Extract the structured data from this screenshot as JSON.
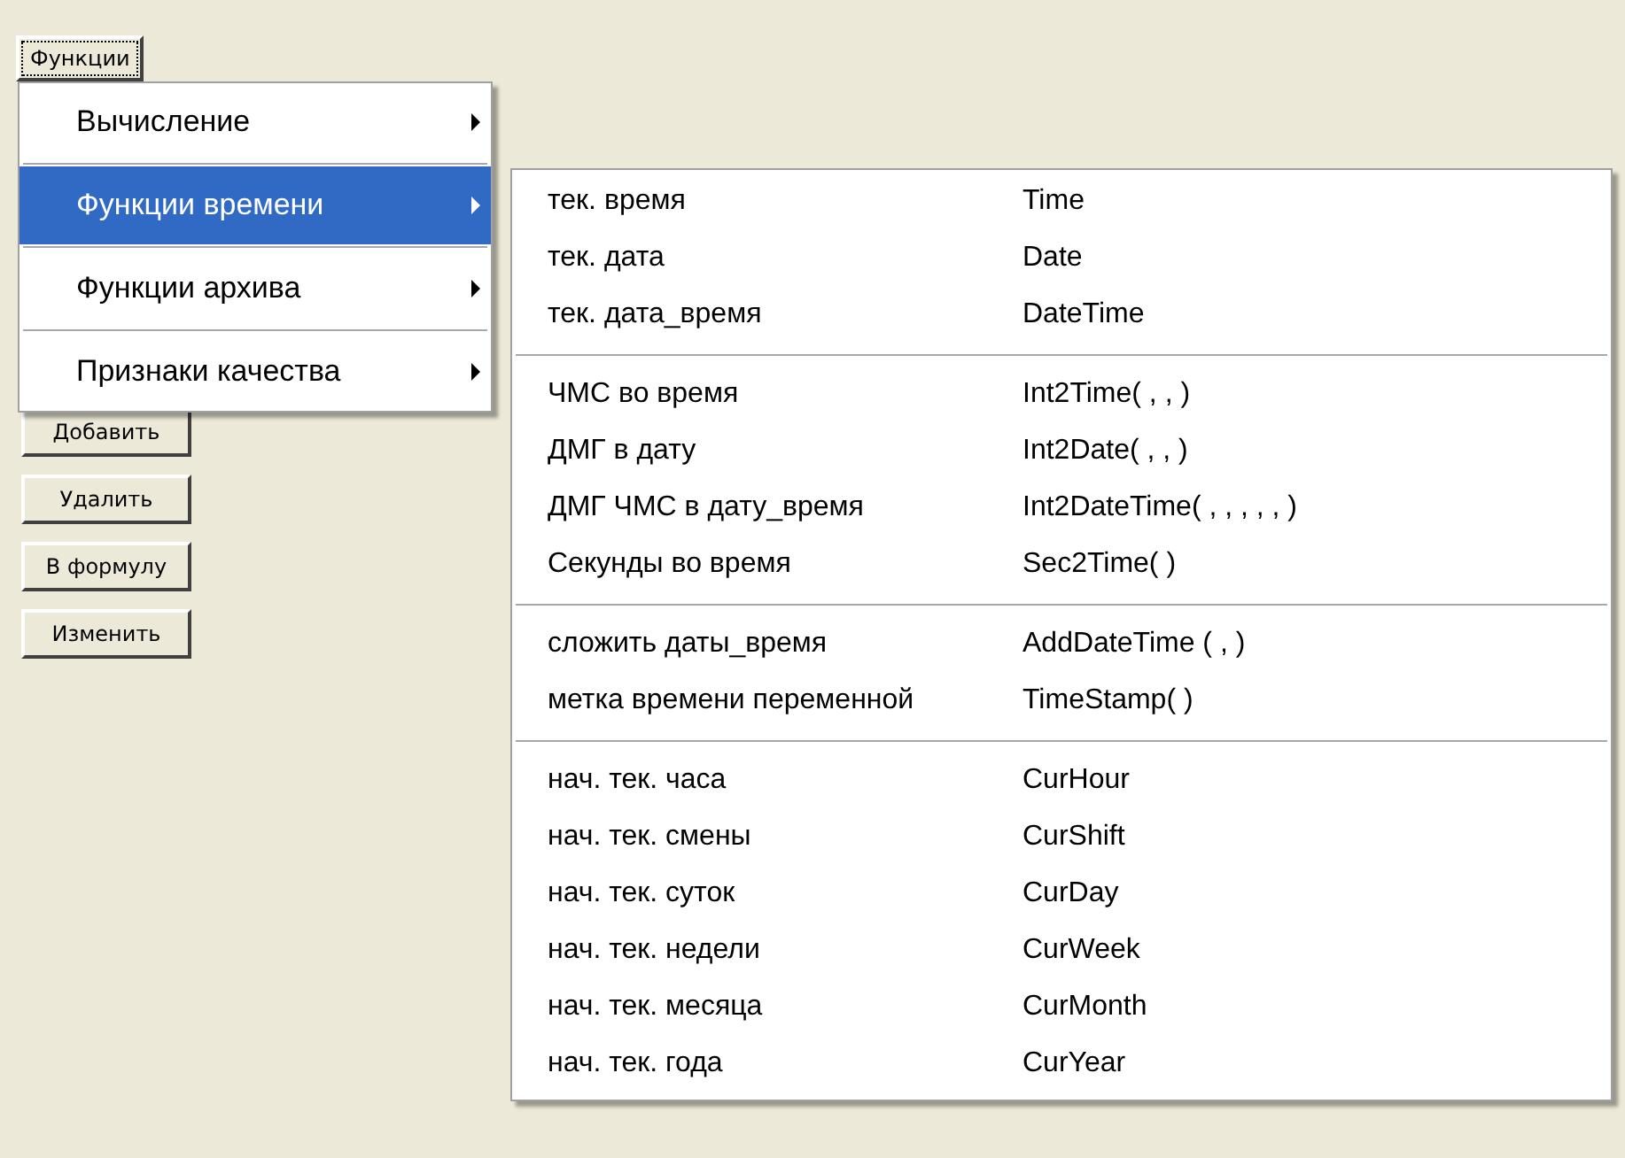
{
  "functions_button": {
    "label": "Функции",
    "focused": true
  },
  "buttons": [
    "Добавить",
    "Удалить",
    "В формулу",
    "Изменить"
  ],
  "menu": [
    {
      "label": "Вычисление",
      "selected": false,
      "has_submenu": true
    },
    {
      "label": "Функции времени",
      "selected": true,
      "has_submenu": true
    },
    {
      "label": "Функции архива",
      "selected": false,
      "has_submenu": true
    },
    {
      "label": "Признаки качества",
      "selected": false,
      "has_submenu": true
    }
  ],
  "submenu": [
    [
      {
        "label": "тек. время",
        "function": "Time"
      },
      {
        "label": "тек. дата",
        "function": "Date"
      },
      {
        "label": "тек. дата_время",
        "function": "DateTime"
      }
    ],
    [
      {
        "label": "ЧМС во время",
        "function": "Int2Time( , , )"
      },
      {
        "label": "ДМГ в дату",
        "function": "Int2Date( , , )"
      },
      {
        "label": "ДМГ ЧМС в дату_время",
        "function": "Int2DateTime( , , , , , )"
      },
      {
        "label": "Секунды во время",
        "function": "Sec2Time( )"
      }
    ],
    [
      {
        "label": "сложить даты_время",
        "function": "AddDateTime ( , )"
      },
      {
        "label": "метка времени переменной",
        "function": "TimeStamp( )"
      }
    ],
    [
      {
        "label": "нач. тек. часа",
        "function": "CurHour"
      },
      {
        "label": "нач. тек. смены",
        "function": "CurShift"
      },
      {
        "label": "нач. тек. суток",
        "function": "CurDay"
      },
      {
        "label": "нач. тек. недели",
        "function": "CurWeek"
      },
      {
        "label": "нач. тек. месяца",
        "function": "CurMonth"
      },
      {
        "label": "нач. тек. года",
        "function": "CurYear"
      }
    ]
  ]
}
